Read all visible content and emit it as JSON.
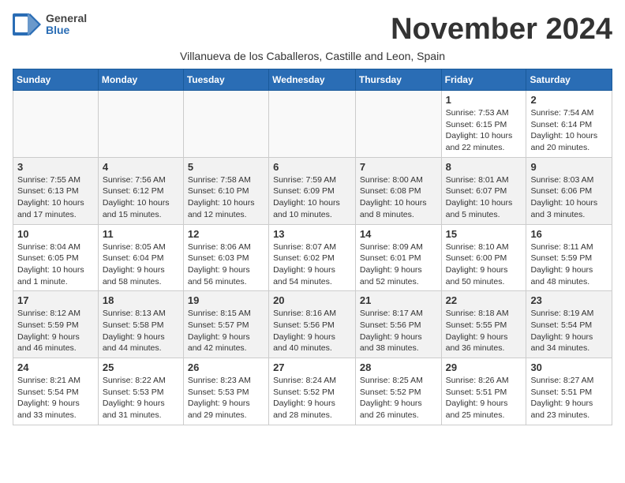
{
  "header": {
    "logo_general": "General",
    "logo_blue": "Blue",
    "month_title": "November 2024",
    "subtitle": "Villanueva de los Caballeros, Castille and Leon, Spain"
  },
  "weekdays": [
    "Sunday",
    "Monday",
    "Tuesday",
    "Wednesday",
    "Thursday",
    "Friday",
    "Saturday"
  ],
  "weeks": [
    [
      {
        "day": "",
        "info": ""
      },
      {
        "day": "",
        "info": ""
      },
      {
        "day": "",
        "info": ""
      },
      {
        "day": "",
        "info": ""
      },
      {
        "day": "",
        "info": ""
      },
      {
        "day": "1",
        "info": "Sunrise: 7:53 AM\nSunset: 6:15 PM\nDaylight: 10 hours and 22 minutes."
      },
      {
        "day": "2",
        "info": "Sunrise: 7:54 AM\nSunset: 6:14 PM\nDaylight: 10 hours and 20 minutes."
      }
    ],
    [
      {
        "day": "3",
        "info": "Sunrise: 7:55 AM\nSunset: 6:13 PM\nDaylight: 10 hours and 17 minutes."
      },
      {
        "day": "4",
        "info": "Sunrise: 7:56 AM\nSunset: 6:12 PM\nDaylight: 10 hours and 15 minutes."
      },
      {
        "day": "5",
        "info": "Sunrise: 7:58 AM\nSunset: 6:10 PM\nDaylight: 10 hours and 12 minutes."
      },
      {
        "day": "6",
        "info": "Sunrise: 7:59 AM\nSunset: 6:09 PM\nDaylight: 10 hours and 10 minutes."
      },
      {
        "day": "7",
        "info": "Sunrise: 8:00 AM\nSunset: 6:08 PM\nDaylight: 10 hours and 8 minutes."
      },
      {
        "day": "8",
        "info": "Sunrise: 8:01 AM\nSunset: 6:07 PM\nDaylight: 10 hours and 5 minutes."
      },
      {
        "day": "9",
        "info": "Sunrise: 8:03 AM\nSunset: 6:06 PM\nDaylight: 10 hours and 3 minutes."
      }
    ],
    [
      {
        "day": "10",
        "info": "Sunrise: 8:04 AM\nSunset: 6:05 PM\nDaylight: 10 hours and 1 minute."
      },
      {
        "day": "11",
        "info": "Sunrise: 8:05 AM\nSunset: 6:04 PM\nDaylight: 9 hours and 58 minutes."
      },
      {
        "day": "12",
        "info": "Sunrise: 8:06 AM\nSunset: 6:03 PM\nDaylight: 9 hours and 56 minutes."
      },
      {
        "day": "13",
        "info": "Sunrise: 8:07 AM\nSunset: 6:02 PM\nDaylight: 9 hours and 54 minutes."
      },
      {
        "day": "14",
        "info": "Sunrise: 8:09 AM\nSunset: 6:01 PM\nDaylight: 9 hours and 52 minutes."
      },
      {
        "day": "15",
        "info": "Sunrise: 8:10 AM\nSunset: 6:00 PM\nDaylight: 9 hours and 50 minutes."
      },
      {
        "day": "16",
        "info": "Sunrise: 8:11 AM\nSunset: 5:59 PM\nDaylight: 9 hours and 48 minutes."
      }
    ],
    [
      {
        "day": "17",
        "info": "Sunrise: 8:12 AM\nSunset: 5:59 PM\nDaylight: 9 hours and 46 minutes."
      },
      {
        "day": "18",
        "info": "Sunrise: 8:13 AM\nSunset: 5:58 PM\nDaylight: 9 hours and 44 minutes."
      },
      {
        "day": "19",
        "info": "Sunrise: 8:15 AM\nSunset: 5:57 PM\nDaylight: 9 hours and 42 minutes."
      },
      {
        "day": "20",
        "info": "Sunrise: 8:16 AM\nSunset: 5:56 PM\nDaylight: 9 hours and 40 minutes."
      },
      {
        "day": "21",
        "info": "Sunrise: 8:17 AM\nSunset: 5:56 PM\nDaylight: 9 hours and 38 minutes."
      },
      {
        "day": "22",
        "info": "Sunrise: 8:18 AM\nSunset: 5:55 PM\nDaylight: 9 hours and 36 minutes."
      },
      {
        "day": "23",
        "info": "Sunrise: 8:19 AM\nSunset: 5:54 PM\nDaylight: 9 hours and 34 minutes."
      }
    ],
    [
      {
        "day": "24",
        "info": "Sunrise: 8:21 AM\nSunset: 5:54 PM\nDaylight: 9 hours and 33 minutes."
      },
      {
        "day": "25",
        "info": "Sunrise: 8:22 AM\nSunset: 5:53 PM\nDaylight: 9 hours and 31 minutes."
      },
      {
        "day": "26",
        "info": "Sunrise: 8:23 AM\nSunset: 5:53 PM\nDaylight: 9 hours and 29 minutes."
      },
      {
        "day": "27",
        "info": "Sunrise: 8:24 AM\nSunset: 5:52 PM\nDaylight: 9 hours and 28 minutes."
      },
      {
        "day": "28",
        "info": "Sunrise: 8:25 AM\nSunset: 5:52 PM\nDaylight: 9 hours and 26 minutes."
      },
      {
        "day": "29",
        "info": "Sunrise: 8:26 AM\nSunset: 5:51 PM\nDaylight: 9 hours and 25 minutes."
      },
      {
        "day": "30",
        "info": "Sunrise: 8:27 AM\nSunset: 5:51 PM\nDaylight: 9 hours and 23 minutes."
      }
    ]
  ]
}
